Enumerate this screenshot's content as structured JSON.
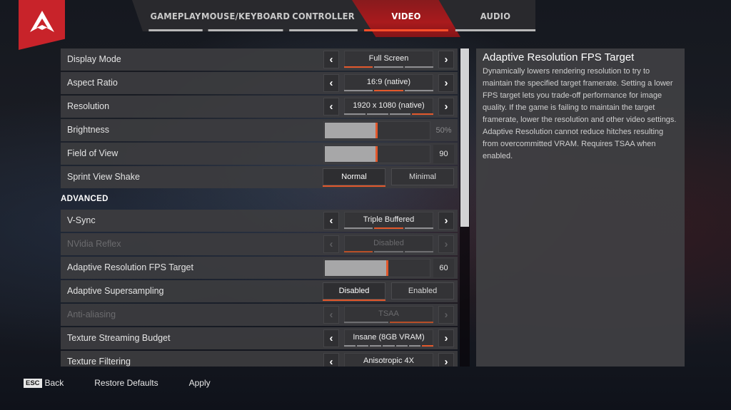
{
  "brand": {
    "logo": "apex-legends-logo",
    "accent": "#c8232a",
    "highlight": "#e2582c"
  },
  "tabs": [
    {
      "label": "GAMEPLAY",
      "active": false
    },
    {
      "label": "MOUSE/KEYBOARD",
      "active": false
    },
    {
      "label": "CONTROLLER",
      "active": false
    },
    {
      "label": "VIDEO",
      "active": true
    },
    {
      "label": "AUDIO",
      "active": false
    }
  ],
  "settings": {
    "basic": [
      {
        "label": "Display Mode",
        "type": "selector",
        "value": "Full Screen",
        "option_count": 3,
        "selected_index": 0,
        "enabled": true
      },
      {
        "label": "Aspect Ratio",
        "type": "selector",
        "value": "16:9 (native)",
        "option_count": 3,
        "selected_index": 1,
        "enabled": true
      },
      {
        "label": "Resolution",
        "type": "selector",
        "value": "1920 x 1080 (native)",
        "option_count": 4,
        "selected_index": 3,
        "enabled": true
      },
      {
        "label": "Brightness",
        "type": "slider",
        "value": "50%",
        "fraction": 0.5,
        "enabled": true
      },
      {
        "label": "Field of View",
        "type": "slider",
        "value": "90",
        "fraction": 0.5,
        "enabled": true
      },
      {
        "label": "Sprint View Shake",
        "type": "toggle",
        "options": [
          "Normal",
          "Minimal"
        ],
        "selected_index": 0,
        "enabled": true
      }
    ],
    "advanced_header": "ADVANCED",
    "advanced": [
      {
        "label": "V-Sync",
        "type": "selector",
        "value": "Triple Buffered",
        "option_count": 3,
        "selected_index": 1,
        "enabled": true
      },
      {
        "label": "NVidia Reflex",
        "type": "selector",
        "value": "Disabled",
        "option_count": 3,
        "selected_index": 0,
        "enabled": false
      },
      {
        "label": "Adaptive Resolution FPS Target",
        "type": "slider",
        "value": "60",
        "fraction": 0.6,
        "enabled": true
      },
      {
        "label": "Adaptive Supersampling",
        "type": "toggle",
        "options": [
          "Disabled",
          "Enabled"
        ],
        "selected_index": 0,
        "enabled": true
      },
      {
        "label": "Anti-aliasing",
        "type": "selector",
        "value": "TSAA",
        "option_count": 2,
        "selected_index": 1,
        "enabled": false
      },
      {
        "label": "Texture Streaming Budget",
        "type": "selector",
        "value": "Insane (8GB VRAM)",
        "option_count": 7,
        "selected_index": 6,
        "enabled": true
      },
      {
        "label": "Texture Filtering",
        "type": "selector",
        "value": "Anisotropic 4X",
        "option_count": 7,
        "selected_index": 4,
        "enabled": true
      }
    ]
  },
  "description": {
    "title": "Adaptive Resolution FPS Target",
    "body": "Dynamically lowers rendering resolution to try to maintain the specified target framerate. Setting a lower FPS target lets you trade-off performance for image quality. If the game is failing to maintain the target framerate, lower the resolution and other video settings. Adaptive Resolution cannot reduce hitches resulting from overcommitted VRAM. Requires TSAA when enabled."
  },
  "footer": {
    "back_key": "ESC",
    "back_label": "Back",
    "restore_label": "Restore Defaults",
    "apply_label": "Apply"
  },
  "icons": {
    "left": "‹",
    "right": "›"
  }
}
